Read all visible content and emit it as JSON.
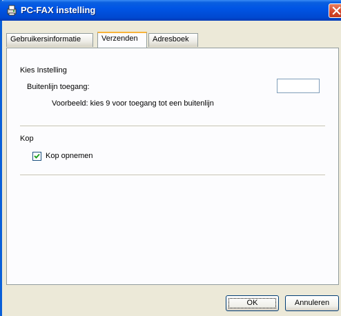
{
  "window": {
    "title": "PC-FAX instelling",
    "title_icon": "fax-printer-icon",
    "close_icon": "close-icon"
  },
  "tabs": [
    {
      "label": "Gebruikersinformatie",
      "active": false
    },
    {
      "label": "Verzenden",
      "active": true
    },
    {
      "label": "Adresboek",
      "active": false
    }
  ],
  "dial_settings": {
    "group_title": "Kies Instelling",
    "outside_line_label": "Buitenlijn toegang:",
    "outside_line_value": "",
    "hint": "Voorbeeld: kies 9 voor toegang tot een buitenlijn"
  },
  "header": {
    "group_title": "Kop",
    "include_header_label": "Kop opnemen",
    "include_header_checked": true
  },
  "buttons": {
    "ok_label": "OK",
    "cancel_label": "Annuleren"
  },
  "colors": {
    "titlebar": "#0055e5",
    "close_button": "#d6452a",
    "tab_highlight": "#f8b33a",
    "dialog_background": "#ece9d8"
  }
}
